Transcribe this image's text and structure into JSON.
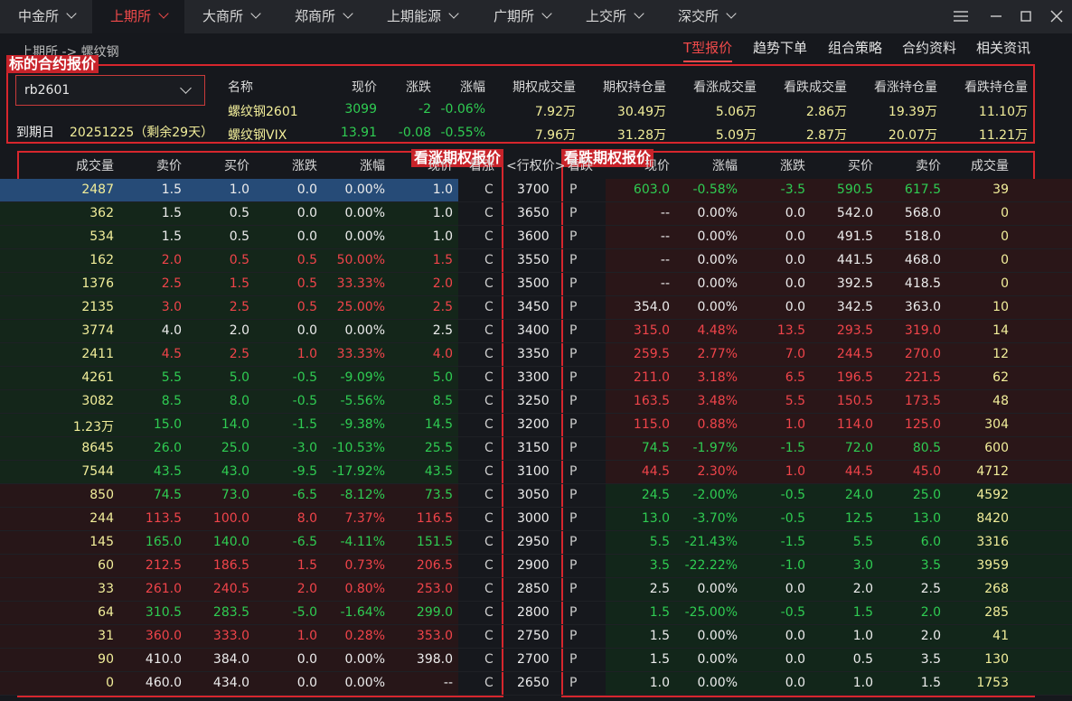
{
  "exchange_tabs": [
    {
      "label": "中金所",
      "active": false
    },
    {
      "label": "上期所",
      "active": true
    },
    {
      "label": "大商所",
      "active": false
    },
    {
      "label": "郑商所",
      "active": false
    },
    {
      "label": "上期能源",
      "active": false
    },
    {
      "label": "广期所",
      "active": false
    },
    {
      "label": "上交所",
      "active": false
    },
    {
      "label": "深交所",
      "active": false
    }
  ],
  "breadcrumb": "上期所 -> 螺纹钢",
  "sub_tabs": [
    {
      "label": "T型报价",
      "active": true
    },
    {
      "label": "趋势下单",
      "active": false
    },
    {
      "label": "组合策略",
      "active": false
    },
    {
      "label": "合约资料",
      "active": false
    },
    {
      "label": "相关资讯",
      "active": false
    }
  ],
  "annotations": {
    "underlying": "标的合约报价",
    "call": "看涨期权报价",
    "put": "看跌期权报价"
  },
  "underlying": {
    "contract": "rb2601",
    "expiry_label": "到期日",
    "expiry_value": "20251225（剩余29天）",
    "headers": [
      "名称",
      "现价",
      "涨跌",
      "涨幅",
      "期权成交量",
      "期权持仓量",
      "看涨成交量",
      "看跌成交量",
      "看涨持仓量",
      "看跌持仓量"
    ],
    "rows": [
      [
        "螺纹钢2601",
        "3099",
        "-2",
        "-0.06%",
        "7.92万",
        "30.49万",
        "5.06万",
        "2.86万",
        "19.39万",
        "11.10万"
      ],
      [
        "螺纹钢VIX",
        "13.91",
        "-0.08",
        "-0.55%",
        "7.96万",
        "31.28万",
        "5.09万",
        "2.87万",
        "20.07万",
        "11.21万"
      ]
    ]
  },
  "table_headers": {
    "call": [
      "成交量",
      "卖价",
      "买价",
      "涨跌",
      "涨幅",
      "现价",
      "看涨"
    ],
    "strike": "<行权价>",
    "put": [
      "看跌",
      "现价",
      "涨幅",
      "涨跌",
      "买价",
      "卖价",
      "成交量"
    ]
  },
  "rows": [
    {
      "call": [
        "2487",
        "1.5",
        "1.0",
        "0.0",
        "0.00%",
        "1.0",
        "C"
      ],
      "strike": "3700",
      "put": [
        "P",
        "603.0",
        "-0.58%",
        "-3.5",
        "590.5",
        "617.5",
        "39"
      ]
    },
    {
      "call": [
        "362",
        "1.5",
        "0.5",
        "0.0",
        "0.00%",
        "1.0",
        "C"
      ],
      "strike": "3650",
      "put": [
        "P",
        "--",
        "0.00%",
        "0.0",
        "542.0",
        "568.0",
        "0"
      ]
    },
    {
      "call": [
        "534",
        "1.5",
        "0.5",
        "0.0",
        "0.00%",
        "1.0",
        "C"
      ],
      "strike": "3600",
      "put": [
        "P",
        "--",
        "0.00%",
        "0.0",
        "491.5",
        "518.0",
        "0"
      ]
    },
    {
      "call": [
        "162",
        "2.0",
        "0.5",
        "0.5",
        "50.00%",
        "1.5",
        "C"
      ],
      "strike": "3550",
      "put": [
        "P",
        "--",
        "0.00%",
        "0.0",
        "441.5",
        "468.0",
        "0"
      ]
    },
    {
      "call": [
        "1376",
        "2.5",
        "1.5",
        "0.5",
        "33.33%",
        "2.0",
        "C"
      ],
      "strike": "3500",
      "put": [
        "P",
        "--",
        "0.00%",
        "0.0",
        "392.5",
        "418.5",
        "0"
      ]
    },
    {
      "call": [
        "2135",
        "3.0",
        "2.5",
        "0.5",
        "25.00%",
        "2.5",
        "C"
      ],
      "strike": "3450",
      "put": [
        "P",
        "354.0",
        "0.00%",
        "0.0",
        "342.5",
        "363.0",
        "10"
      ]
    },
    {
      "call": [
        "3774",
        "4.0",
        "2.0",
        "0.0",
        "0.00%",
        "2.5",
        "C"
      ],
      "strike": "3400",
      "put": [
        "P",
        "315.0",
        "4.48%",
        "13.5",
        "293.5",
        "319.0",
        "14"
      ]
    },
    {
      "call": [
        "2411",
        "4.5",
        "2.5",
        "1.0",
        "33.33%",
        "4.0",
        "C"
      ],
      "strike": "3350",
      "put": [
        "P",
        "259.5",
        "2.77%",
        "7.0",
        "244.5",
        "270.0",
        "12"
      ]
    },
    {
      "call": [
        "4261",
        "5.5",
        "5.0",
        "-0.5",
        "-9.09%",
        "5.0",
        "C"
      ],
      "strike": "3300",
      "put": [
        "P",
        "211.0",
        "3.18%",
        "6.5",
        "196.5",
        "221.5",
        "62"
      ]
    },
    {
      "call": [
        "3082",
        "8.5",
        "8.0",
        "-0.5",
        "-5.56%",
        "8.5",
        "C"
      ],
      "strike": "3250",
      "put": [
        "P",
        "163.5",
        "3.48%",
        "5.5",
        "150.5",
        "173.5",
        "48"
      ]
    },
    {
      "call": [
        "1.23万",
        "15.0",
        "14.0",
        "-1.5",
        "-9.38%",
        "14.5",
        "C"
      ],
      "strike": "3200",
      "put": [
        "P",
        "115.0",
        "0.88%",
        "1.0",
        "114.0",
        "125.0",
        "304"
      ]
    },
    {
      "call": [
        "8645",
        "26.0",
        "25.0",
        "-3.0",
        "-10.53%",
        "25.5",
        "C"
      ],
      "strike": "3150",
      "put": [
        "P",
        "74.5",
        "-1.97%",
        "-1.5",
        "72.0",
        "80.5",
        "600"
      ]
    },
    {
      "call": [
        "7544",
        "43.5",
        "43.0",
        "-9.5",
        "-17.92%",
        "43.5",
        "C"
      ],
      "strike": "3100",
      "put": [
        "P",
        "44.5",
        "2.30%",
        "1.0",
        "44.5",
        "45.0",
        "4712"
      ]
    },
    {
      "call": [
        "850",
        "74.5",
        "73.0",
        "-6.5",
        "-8.12%",
        "73.5",
        "C"
      ],
      "strike": "3050",
      "put": [
        "P",
        "24.5",
        "-2.00%",
        "-0.5",
        "24.0",
        "25.0",
        "4592"
      ]
    },
    {
      "call": [
        "244",
        "113.5",
        "100.0",
        "8.0",
        "7.37%",
        "116.5",
        "C"
      ],
      "strike": "3000",
      "put": [
        "P",
        "13.0",
        "-3.70%",
        "-0.5",
        "12.5",
        "13.0",
        "8420"
      ]
    },
    {
      "call": [
        "145",
        "165.0",
        "140.0",
        "-6.5",
        "-4.11%",
        "151.5",
        "C"
      ],
      "strike": "2950",
      "put": [
        "P",
        "5.5",
        "-21.43%",
        "-1.5",
        "5.5",
        "6.0",
        "3316"
      ]
    },
    {
      "call": [
        "60",
        "212.5",
        "186.5",
        "1.5",
        "0.73%",
        "206.5",
        "C"
      ],
      "strike": "2900",
      "put": [
        "P",
        "3.5",
        "-22.22%",
        "-1.0",
        "3.0",
        "3.5",
        "3959"
      ]
    },
    {
      "call": [
        "33",
        "261.0",
        "240.5",
        "2.0",
        "0.80%",
        "253.0",
        "C"
      ],
      "strike": "2850",
      "put": [
        "P",
        "2.5",
        "0.00%",
        "0.0",
        "2.0",
        "2.5",
        "268"
      ]
    },
    {
      "call": [
        "64",
        "310.5",
        "283.5",
        "-5.0",
        "-1.64%",
        "299.0",
        "C"
      ],
      "strike": "2800",
      "put": [
        "P",
        "1.5",
        "-25.00%",
        "-0.5",
        "1.5",
        "2.0",
        "285"
      ]
    },
    {
      "call": [
        "31",
        "360.0",
        "333.0",
        "1.0",
        "0.28%",
        "353.0",
        "C"
      ],
      "strike": "2750",
      "put": [
        "P",
        "1.5",
        "0.00%",
        "0.0",
        "1.0",
        "2.0",
        "41"
      ]
    },
    {
      "call": [
        "90",
        "410.0",
        "384.0",
        "0.0",
        "0.00%",
        "398.0",
        "C"
      ],
      "strike": "2700",
      "put": [
        "P",
        "1.5",
        "0.00%",
        "0.0",
        "0.5",
        "3.5",
        "130"
      ]
    },
    {
      "call": [
        "0",
        "460.0",
        "434.0",
        "0.0",
        "0.00%",
        "--",
        "C"
      ],
      "strike": "2650",
      "put": [
        "P",
        "1.0",
        "0.00%",
        "0.0",
        "1.0",
        "1.5",
        "1753"
      ]
    }
  ],
  "colors": {
    "up": "#f0444a",
    "down": "#2fcc52",
    "flat": "#ececec",
    "volume": "#f2ee9a",
    "call_itm_bg": "#122519",
    "call_otm_bg": "#251417",
    "put_itm_bg": "#2a1618",
    "put_otm_bg": "#12261a",
    "selected_bg": "#264b77"
  },
  "icons": [
    "menu-icon",
    "minimize-icon",
    "maximize-icon",
    "close-icon",
    "chevron-down-icon"
  ]
}
